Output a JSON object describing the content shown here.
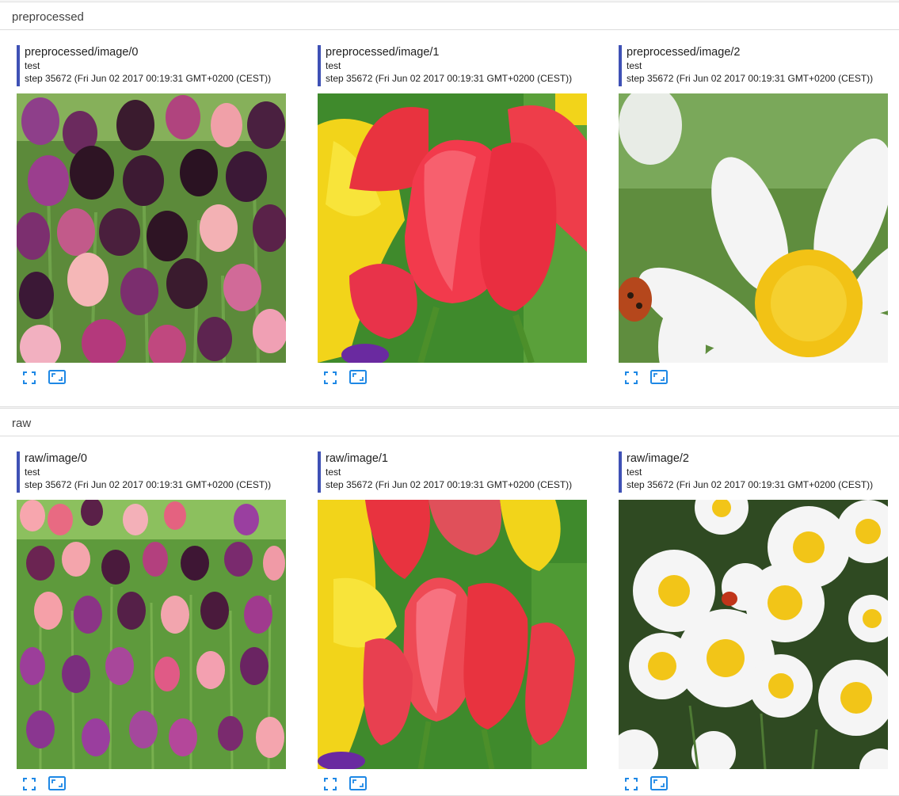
{
  "colors": {
    "accent": "#3f51b5",
    "icon": "#1e88e5"
  },
  "sections": [
    {
      "title": "preprocessed",
      "cards": [
        {
          "title": "preprocessed/image/0",
          "run": "test",
          "step": "step 35672 (Fri Jun 02 2017 00:19:31 GMT+0200 (CEST))"
        },
        {
          "title": "preprocessed/image/1",
          "run": "test",
          "step": "step 35672 (Fri Jun 02 2017 00:19:31 GMT+0200 (CEST))"
        },
        {
          "title": "preprocessed/image/2",
          "run": "test",
          "step": "step 35672 (Fri Jun 02 2017 00:19:31 GMT+0200 (CEST))"
        }
      ]
    },
    {
      "title": "raw",
      "cards": [
        {
          "title": "raw/image/0",
          "run": "test",
          "step": "step 35672 (Fri Jun 02 2017 00:19:31 GMT+0200 (CEST))"
        },
        {
          "title": "raw/image/1",
          "run": "test",
          "step": "step 35672 (Fri Jun 02 2017 00:19:31 GMT+0200 (CEST))"
        },
        {
          "title": "raw/image/2",
          "run": "test",
          "step": "step 35672 (Fri Jun 02 2017 00:19:31 GMT+0200 (CEST))"
        }
      ]
    }
  ],
  "icons": {
    "expand": "fullscreen-icon",
    "actual_size": "aspect-ratio-icon"
  }
}
